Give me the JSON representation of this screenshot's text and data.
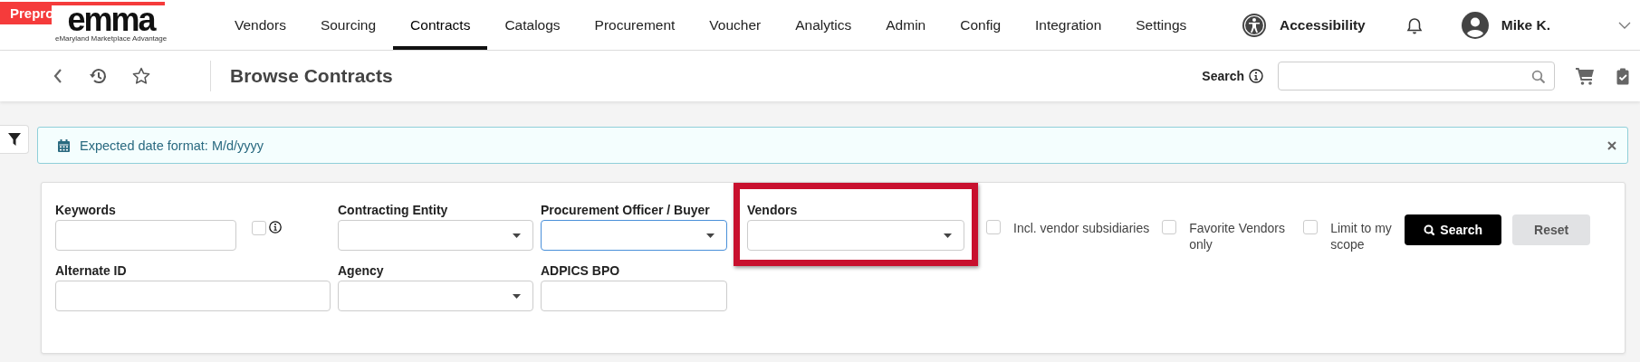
{
  "environment_banner": "Prepro",
  "logo": {
    "wordmark": "emma",
    "tagline": "eMaryland Marketplace Advantage"
  },
  "nav": [
    {
      "label": "Vendors",
      "selected": false
    },
    {
      "label": "Sourcing",
      "selected": false
    },
    {
      "label": "Contracts",
      "selected": true
    },
    {
      "label": "Catalogs",
      "selected": false
    },
    {
      "label": "Procurement",
      "selected": false
    },
    {
      "label": "Voucher",
      "selected": false
    },
    {
      "label": "Analytics",
      "selected": false
    },
    {
      "label": "Admin",
      "selected": false
    },
    {
      "label": "Config",
      "selected": false
    },
    {
      "label": "Integration",
      "selected": false
    },
    {
      "label": "Settings",
      "selected": false
    }
  ],
  "accessibility": "Accessibility",
  "user": "Mike K.",
  "user_menu_expanded": false,
  "page_title": "Browse Contracts",
  "search_label": "Search",
  "alert": {
    "text": "Expected date format: M/d/yyyy"
  },
  "form": {
    "rows": [
      [
        {
          "kind": "text",
          "label": "Keywords",
          "checkbox": {
            "checked": false
          }
        },
        {
          "kind": "select",
          "label": "Contracting Entity"
        },
        {
          "kind": "select",
          "label": "Procurement Officer / Buyer",
          "focused": true
        },
        {
          "kind": "select",
          "label": "Vendors",
          "highlighted": true
        }
      ],
      [
        {
          "kind": "text",
          "label": "Alternate ID"
        },
        {
          "kind": "select",
          "label": "Agency"
        },
        {
          "kind": "text",
          "label": "ADPICS BPO"
        }
      ]
    ],
    "options": [
      {
        "label": "Incl. vendor subsidiaries",
        "checked": false
      },
      {
        "label": "Favorite Vendors only",
        "checked": false
      },
      {
        "label": "Limit to my scope",
        "checked": false
      }
    ],
    "buttons": [
      {
        "label": "Search",
        "kind": "primary"
      },
      {
        "label": "Reset",
        "kind": "secondary"
      }
    ]
  }
}
